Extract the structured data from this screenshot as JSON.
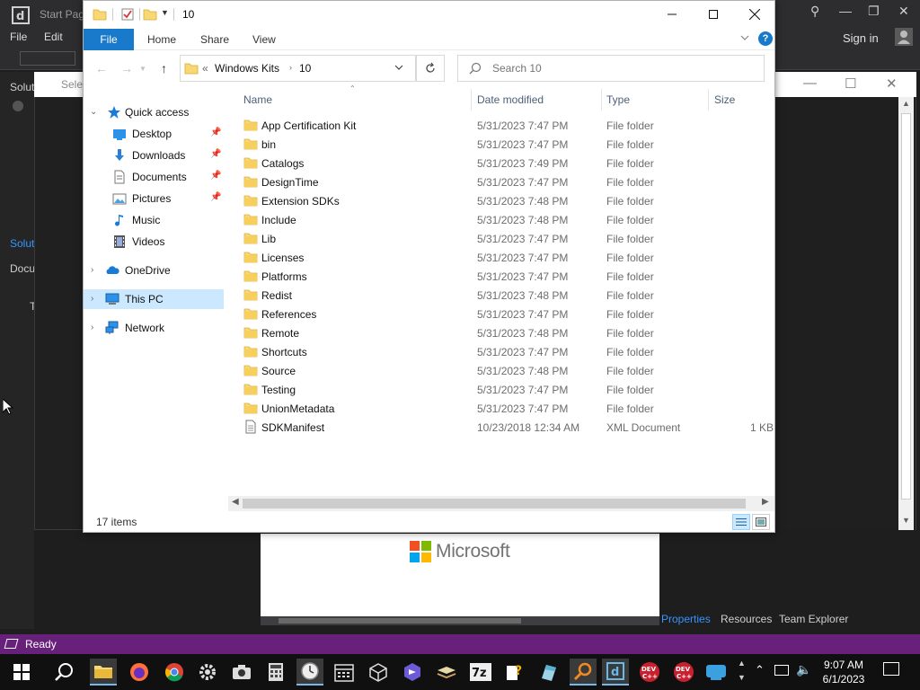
{
  "ide": {
    "tab_title": "Start Page",
    "menu": [
      "File",
      "Edit"
    ],
    "sign_in": "Sign in",
    "side_labels": [
      "Solut",
      "Solut",
      "Docu",
      "T"
    ],
    "dialog_title": "Selec",
    "bottom_tabs": [
      "Properties",
      "Resources",
      "Team Explorer"
    ],
    "status": "Ready",
    "preview_brand": "Microsoft",
    "status_color": "#68217a",
    "accent": "#3794ff"
  },
  "explorer": {
    "title": "10",
    "ribbon_tabs": [
      "File",
      "Home",
      "Share",
      "View"
    ],
    "address": {
      "prefix": "«",
      "crumbs": [
        "Windows Kits",
        "10"
      ]
    },
    "search_placeholder": "Search 10",
    "nav": {
      "quick_access": "Quick access",
      "pinned": [
        "Desktop",
        "Downloads",
        "Documents",
        "Pictures"
      ],
      "unpinned": [
        "Music",
        "Videos"
      ],
      "onedrive": "OneDrive",
      "this_pc": "This PC",
      "network": "Network"
    },
    "columns": {
      "name": "Name",
      "date": "Date modified",
      "type": "Type",
      "size": "Size"
    },
    "files": [
      {
        "name": "App Certification Kit",
        "date": "5/31/2023 7:47 PM",
        "type": "File folder",
        "size": "",
        "kind": "folder"
      },
      {
        "name": "bin",
        "date": "5/31/2023 7:47 PM",
        "type": "File folder",
        "size": "",
        "kind": "folder"
      },
      {
        "name": "Catalogs",
        "date": "5/31/2023 7:49 PM",
        "type": "File folder",
        "size": "",
        "kind": "folder"
      },
      {
        "name": "DesignTime",
        "date": "5/31/2023 7:47 PM",
        "type": "File folder",
        "size": "",
        "kind": "folder"
      },
      {
        "name": "Extension SDKs",
        "date": "5/31/2023 7:48 PM",
        "type": "File folder",
        "size": "",
        "kind": "folder"
      },
      {
        "name": "Include",
        "date": "5/31/2023 7:48 PM",
        "type": "File folder",
        "size": "",
        "kind": "folder"
      },
      {
        "name": "Lib",
        "date": "5/31/2023 7:47 PM",
        "type": "File folder",
        "size": "",
        "kind": "folder"
      },
      {
        "name": "Licenses",
        "date": "5/31/2023 7:47 PM",
        "type": "File folder",
        "size": "",
        "kind": "folder"
      },
      {
        "name": "Platforms",
        "date": "5/31/2023 7:47 PM",
        "type": "File folder",
        "size": "",
        "kind": "folder"
      },
      {
        "name": "Redist",
        "date": "5/31/2023 7:48 PM",
        "type": "File folder",
        "size": "",
        "kind": "folder"
      },
      {
        "name": "References",
        "date": "5/31/2023 7:47 PM",
        "type": "File folder",
        "size": "",
        "kind": "folder"
      },
      {
        "name": "Remote",
        "date": "5/31/2023 7:48 PM",
        "type": "File folder",
        "size": "",
        "kind": "folder"
      },
      {
        "name": "Shortcuts",
        "date": "5/31/2023 7:47 PM",
        "type": "File folder",
        "size": "",
        "kind": "folder"
      },
      {
        "name": "Source",
        "date": "5/31/2023 7:48 PM",
        "type": "File folder",
        "size": "",
        "kind": "folder"
      },
      {
        "name": "Testing",
        "date": "5/31/2023 7:47 PM",
        "type": "File folder",
        "size": "",
        "kind": "folder"
      },
      {
        "name": "UnionMetadata",
        "date": "5/31/2023 7:47 PM",
        "type": "File folder",
        "size": "",
        "kind": "folder"
      },
      {
        "name": "SDKManifest",
        "date": "10/23/2018 12:34 AM",
        "type": "XML Document",
        "size": "1 KB",
        "kind": "xml"
      }
    ],
    "item_count": "17 items",
    "accent": "#1979ca",
    "selection_color": "#cce8ff",
    "folder_color": "#f8d775"
  },
  "taskbar": {
    "time": "9:07 AM",
    "date": "6/1/2023",
    "icons": [
      "windows-start",
      "search",
      "file-explorer",
      "firefox",
      "chrome",
      "settings",
      "camera",
      "calculator",
      "clock",
      "calendar",
      "3d-box",
      "app-purple",
      "layers",
      "7zip",
      "help-app",
      "notepad",
      "search-orange",
      "visual-studio",
      "dev-cpp-1",
      "dev-cpp-2",
      "cloud-app"
    ]
  }
}
